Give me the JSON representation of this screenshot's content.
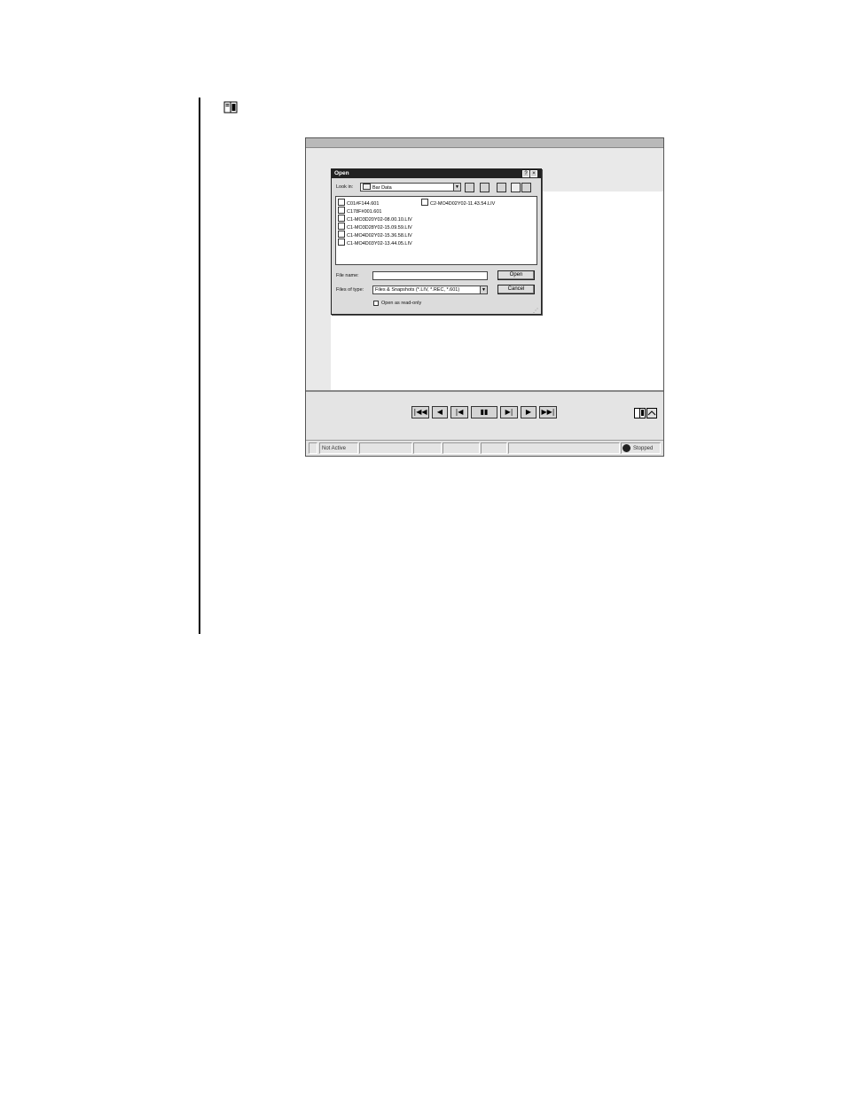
{
  "dialog": {
    "title": "Open",
    "help_button": "?",
    "close_button": "×",
    "look_in_label": "Look in:",
    "look_in_value": "Bar Data",
    "files": [
      "C01#F144.601",
      "C2-MO4D02Y02-11.43.54.LIV",
      "C178F#001.601",
      "C1-MO3D20Y02-08.00.10.LIV",
      "C1-MO3D28Y02-15.09.59.LIV",
      "C1-MO4D02Y02-15.36.58.LIV",
      "C1-MO4D03Y02-13.44.05.LIV"
    ],
    "file_name_label": "File name:",
    "file_name_value": "",
    "files_of_type_label": "Files of type:",
    "files_of_type_value": "Files & Snapshots (*.LIV, *.REC, *.601)",
    "open_button": "Open",
    "cancel_button": "Cancel",
    "readonly_label": "Open as read-only"
  },
  "transport": {
    "first": "|◀◀",
    "prev": "◀",
    "step_back": "|◀",
    "pause": "▮▮",
    "step_forward": "▶|",
    "next": "▶",
    "last": "▶▶|"
  },
  "status": {
    "state": "Not Active",
    "playback": "Stopped"
  },
  "icons": {
    "margin": "book-icon",
    "toolbar_right": [
      "book-icon",
      "export-icon"
    ],
    "folder": "folder-icon",
    "stop": "stop-icon"
  }
}
